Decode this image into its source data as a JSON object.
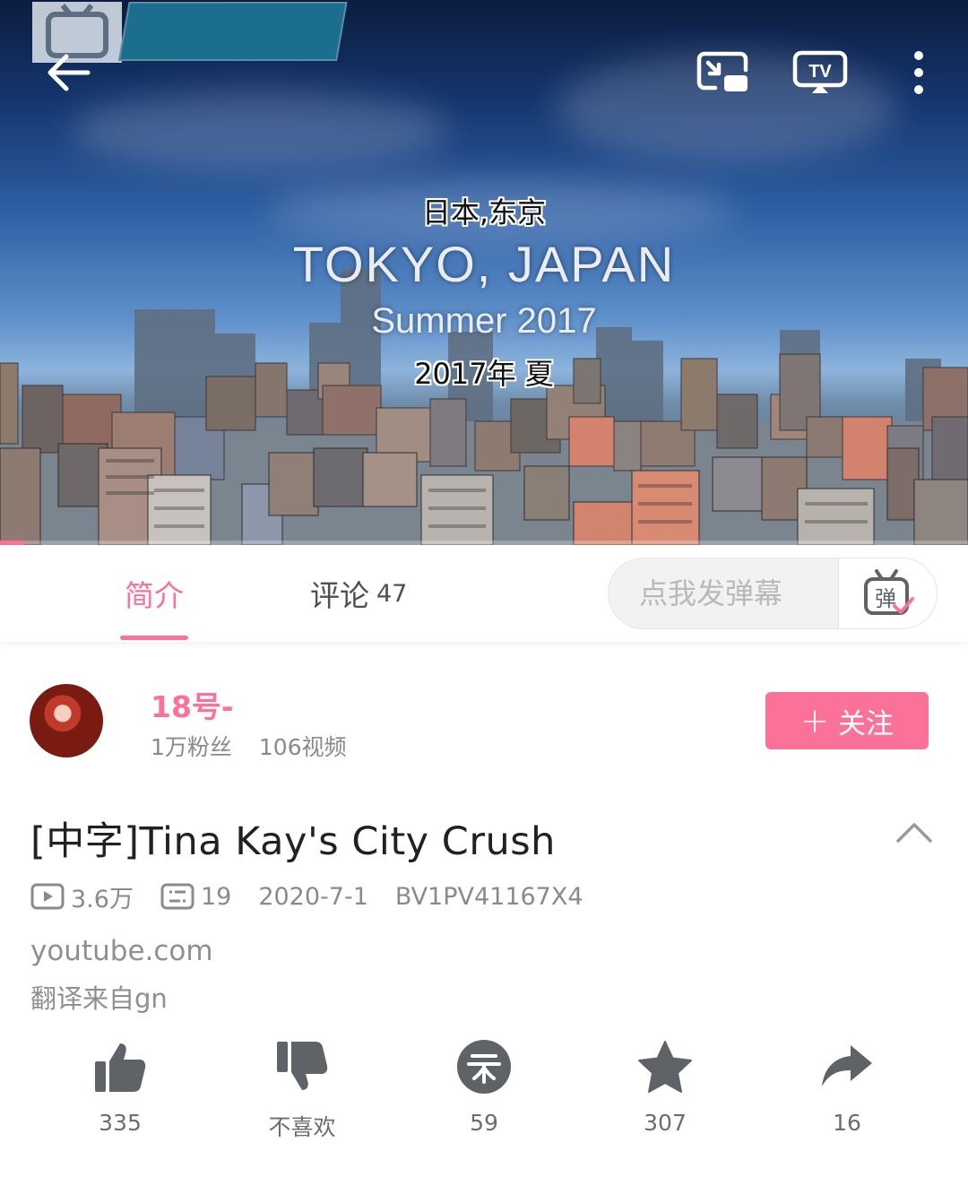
{
  "player": {
    "caption_cn_top": "日本,东京",
    "caption_en": "TOKYO, JAPAN",
    "caption_season": "Summer 2017",
    "caption_cn_bottom": "2017年  夏",
    "progress": 0.025
  },
  "tabs": {
    "intro_label": "简介",
    "comments_label": "评论",
    "comments_count": "47",
    "danmaku_placeholder": "点我发弹幕"
  },
  "uploader": {
    "name": "18号-",
    "followers": "1万粉丝",
    "videos": "106视频",
    "follow_label": "关注"
  },
  "video": {
    "title": "[中字]Tina Kay's City Crush",
    "views": "3.6万",
    "danmaku_count": "19",
    "date": "2020-7-1",
    "bvid": "BV1PV41167X4",
    "source": "youtube.com",
    "description": "翻译来自gn"
  },
  "actions": {
    "like": "335",
    "dislike": "不喜欢",
    "coin": "59",
    "favorite": "307",
    "share": "16"
  },
  "colors": {
    "accent": "#fb7299",
    "icon_gray": "#5f6368",
    "text_gray": "#8a8a8a"
  },
  "icons": [
    "back-arrow-icon",
    "pip-icon",
    "tv-cast-icon",
    "more-vertical-icon",
    "danmaku-toggle-icon",
    "play-count-icon",
    "danmaku-count-icon",
    "chevron-up-icon",
    "thumb-up-icon",
    "thumb-down-icon",
    "coin-icon",
    "star-icon",
    "share-icon"
  ]
}
